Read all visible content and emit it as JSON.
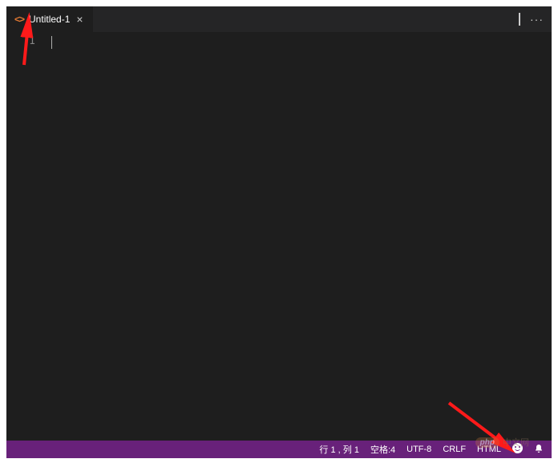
{
  "tab": {
    "icon_name": "html-file-icon",
    "label": "Untitled-1",
    "close_label": "×"
  },
  "editor_actions": {
    "split_tooltip": "Split Editor",
    "more_tooltip": "More Actions"
  },
  "gutter": {
    "line1": "1"
  },
  "statusbar": {
    "cursor_pos": "行 1 , 列 1",
    "indent": "空格:4",
    "encoding": "UTF-8",
    "eol": "CRLF",
    "language": "HTML"
  },
  "watermark": {
    "badge": "php",
    "text": "中文网"
  }
}
